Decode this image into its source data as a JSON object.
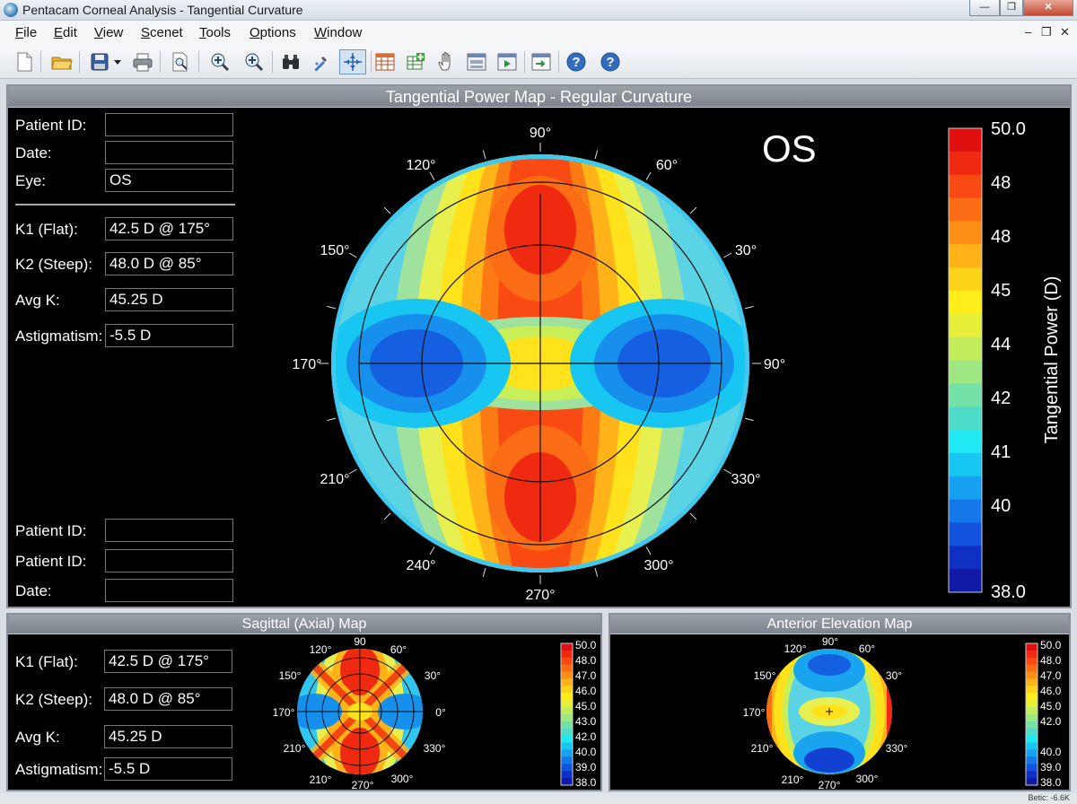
{
  "window": {
    "title": "Pentacam Corneal Analysis - Tangential Curvature",
    "minimize": "—",
    "restore": "❐",
    "close": "✕"
  },
  "menu": {
    "items": [
      {
        "label": "File",
        "hot": "F",
        "rest": "ile"
      },
      {
        "label": "Edit",
        "hot": "E",
        "rest": "dit"
      },
      {
        "label": "View",
        "hot": "V",
        "rest": "iew"
      },
      {
        "label": "Scenet",
        "hot": "S",
        "rest": "cenet"
      },
      {
        "label": "Tools",
        "hot": "T",
        "rest": "ools"
      },
      {
        "label": "Options",
        "hot": "O",
        "rest": "ptions"
      },
      {
        "label": "Window",
        "hot": "W",
        "rest": "indow"
      }
    ],
    "mdi": {
      "minimize": "–",
      "restore": "❐",
      "close": "✕"
    }
  },
  "main": {
    "title": "Tangential Power Map - Regular Curvature",
    "eye_big": "OS",
    "fields_top": [
      {
        "label": "Patient ID:",
        "value": ""
      },
      {
        "label": "Date:",
        "value": ""
      },
      {
        "label": "Eye:",
        "value": "OS"
      }
    ],
    "fields_k": [
      {
        "label": "K1 (Flat):",
        "value": "42.5 D @ 175°"
      },
      {
        "label": "K2 (Steep):",
        "value": "48.0 D @ 85°"
      },
      {
        "label": "Avg K:",
        "value": "45.25 D"
      },
      {
        "label": "Astigmatism:",
        "value": "-5.5 D"
      }
    ],
    "fields_bottom": [
      {
        "label": "Patient ID:",
        "value": ""
      },
      {
        "label": "Patient ID:",
        "value": ""
      },
      {
        "label": "Date:",
        "value": ""
      }
    ],
    "angles": [
      "90°",
      "60°",
      "30°",
      "90°",
      "330°",
      "300°",
      "270°",
      "240°",
      "210°",
      "170°",
      "150°",
      "120°"
    ],
    "colorbar": {
      "labels": [
        "50.0",
        "48",
        "48",
        "45",
        "44",
        "42",
        "41",
        "40",
        "38.0"
      ],
      "title": "Tangential Power (D)",
      "colors": [
        "#e01010",
        "#f02a10",
        "#f84a12",
        "#fb6d14",
        "#fd8f16",
        "#ffb318",
        "#ffd21a",
        "#ffee1c",
        "#e6f03a",
        "#c3ec5c",
        "#9de880",
        "#74e2a6",
        "#4edcc8",
        "#20e8f4",
        "#18c6f2",
        "#16a0f0",
        "#1478e8",
        "#1252dc",
        "#1030c4",
        "#101aa6"
      ]
    }
  },
  "sagittal": {
    "title": "Sagittal (Axial) Map",
    "fields": [
      {
        "label": "K1 (Flat):",
        "value": "42.5 D @ 175°"
      },
      {
        "label": "K2 (Steep):",
        "value": "48.0 D @ 85°"
      },
      {
        "label": "Avg K:",
        "value": "45.25 D"
      },
      {
        "label": "Astigmatism:",
        "value": "-5.5 D"
      }
    ],
    "angles": [
      "90",
      "60°",
      "30°",
      "0°",
      "330°",
      "300°",
      "270°",
      "210°",
      "210°",
      "170°",
      "150°",
      "120°"
    ],
    "colorbar": [
      "50.0",
      "48.0",
      "47.0",
      "46.0",
      "45.0",
      "43.0",
      "42.0",
      "40.0",
      "39.0",
      "38.0"
    ]
  },
  "elevation": {
    "title": "Anterior Elevation Map",
    "angles": [
      "90°",
      "60°",
      "30°",
      "330°",
      "300°",
      "270°",
      "210°",
      "210°",
      "170°",
      "150°",
      "120°"
    ],
    "colorbar": [
      "50.0",
      "48.0",
      "47.0",
      "46.0",
      "45.0",
      "42.0",
      "40.0",
      "39.0",
      "38.0"
    ]
  },
  "status": {
    "text": "Betic: -6.6K"
  }
}
